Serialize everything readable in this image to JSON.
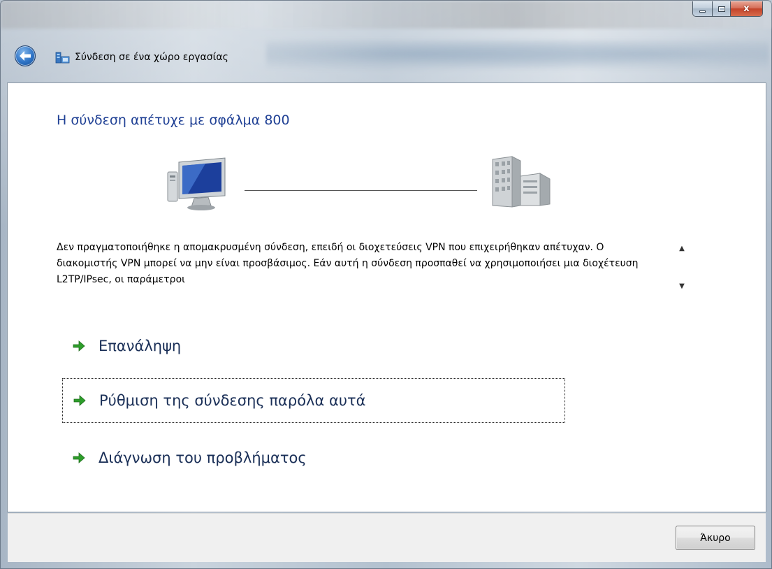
{
  "window": {
    "title": "Σύνδεση σε ένα χώρο εργασίας",
    "close_glyph": "x"
  },
  "page": {
    "heading": "Η σύνδεση απέτυχε με σφάλμα 800",
    "message": "Δεν πραγματοποιήθηκε η απομακρυσμένη σύνδεση, επειδή οι διοχετεύσεις VPN που επιχειρήθηκαν απέτυχαν. Ο διακομιστής VPN μπορεί να μην είναι προσβάσιμος. Εάν αυτή η σύνδεση προσπαθεί να χρησιμοποιήσει μια διοχέτευση L2TP/IPsec, οι παράμετροι"
  },
  "actions": [
    {
      "label": "Επανάληψη"
    },
    {
      "label": "Ρύθμιση της σύνδεσης παρόλα αυτά"
    },
    {
      "label": "Διάγνωση του προβλήματος"
    }
  ],
  "footer": {
    "cancel_label": "Άκυρο"
  },
  "icons": {
    "back": "back-arrow-icon",
    "wizard": "network-place-icon",
    "computer": "computer-icon",
    "server": "server-building-icon",
    "action_arrow": "green-arrow-icon",
    "scroll_up": "▲",
    "scroll_down": "▼"
  },
  "colors": {
    "heading": "#1e3f94",
    "action_text": "#1a2f57",
    "arrow_green": "#2d9e2a",
    "close_button": "#c3432a"
  }
}
